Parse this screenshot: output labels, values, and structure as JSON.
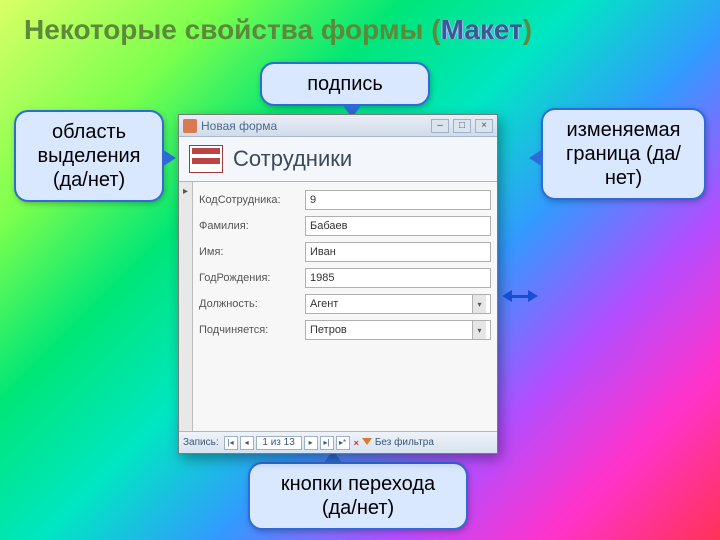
{
  "slide_title_main": "Некоторые свойства формы (",
  "slide_title_mk": "Макет",
  "slide_title_end": ")",
  "callouts": {
    "caption": "подпись",
    "selection": "область выделения (да/нет)",
    "border": "изменяемая граница (да/нет)",
    "nav": "кнопки перехода (да/нет)"
  },
  "window": {
    "title": "Новая форма",
    "form_caption": "Сотрудники",
    "record_selector_glyph": "▸",
    "fields": [
      {
        "label": "КодСотрудника:",
        "value": "9",
        "dropdown": false
      },
      {
        "label": "Фамилия:",
        "value": "Бабаев",
        "dropdown": false
      },
      {
        "label": "Имя:",
        "value": "Иван",
        "dropdown": false
      },
      {
        "label": "ГодРождения:",
        "value": "1985",
        "dropdown": false
      },
      {
        "label": "Должность:",
        "value": "Агент",
        "dropdown": true
      },
      {
        "label": "Подчиняется:",
        "value": "Петров",
        "dropdown": true
      }
    ],
    "nav": {
      "label": "Запись:",
      "first": "|◂",
      "prev": "◂",
      "pos": "1 из 13",
      "next": "▸",
      "last": "▸|",
      "new": "▸*",
      "filter": "Без фильтра"
    },
    "winbtns": {
      "min": "–",
      "max": "□",
      "close": "×"
    }
  }
}
